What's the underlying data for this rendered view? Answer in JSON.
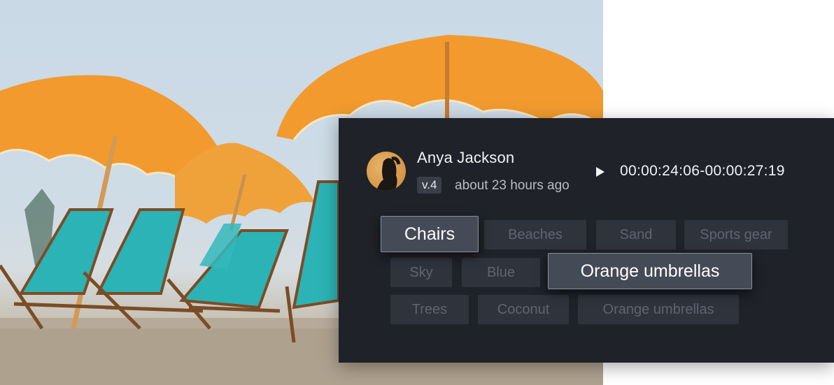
{
  "photo": {
    "subject": "beach-umbrellas-photo"
  },
  "comment": {
    "author": "Anya Jackson",
    "version": "v.4",
    "timestamp": "about 23 hours ago",
    "timecode": "00:00:24:06-00:00:27:19"
  },
  "tags": [
    {
      "label": "Chairs",
      "active": true
    },
    {
      "label": "Beaches",
      "active": false
    },
    {
      "label": "Sand",
      "active": false
    },
    {
      "label": "Sports gear",
      "active": false
    },
    {
      "label": "Sky",
      "active": false
    },
    {
      "label": "Blue",
      "active": false
    },
    {
      "label": "Orange umbrellas",
      "active": true
    },
    {
      "label": "Trees",
      "active": false
    },
    {
      "label": "Coconut",
      "active": false
    },
    {
      "label": "Orange umbrellas",
      "active": false
    }
  ],
  "colors": {
    "panel": "#1f2229",
    "umbrella": "#f29a2e",
    "chair": "#2bb3b5"
  }
}
